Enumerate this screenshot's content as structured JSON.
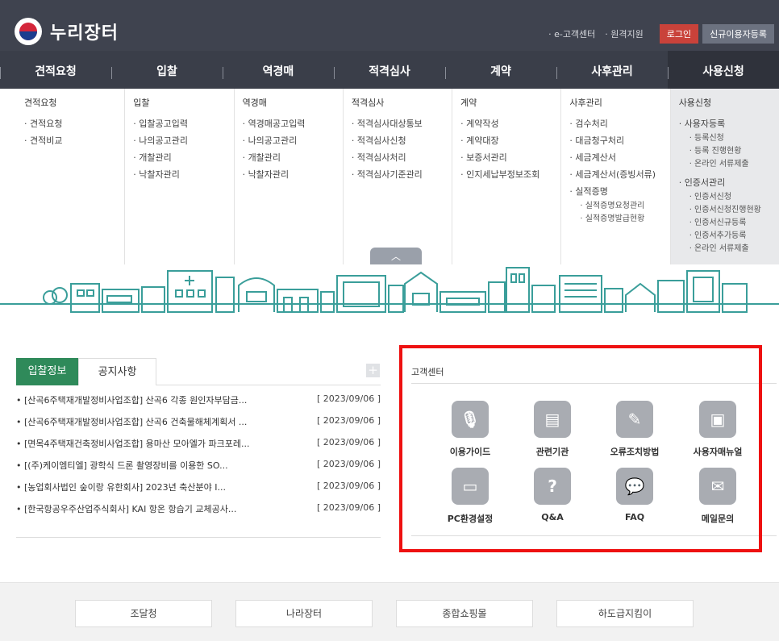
{
  "header": {
    "logo_text": "누리장터",
    "links": [
      "e-고객센터",
      "원격지원"
    ],
    "login": "로그인",
    "join": "신규이용자등록"
  },
  "gnb": [
    "견적요청",
    "입찰",
    "역경매",
    "적격심사",
    "계약",
    "사후관리",
    "사용신청"
  ],
  "mega": [
    {
      "title": "견적요청",
      "items": [
        "견적요청",
        "견적비교"
      ]
    },
    {
      "title": "입찰",
      "items": [
        "입찰공고입력",
        "나의공고관리",
        "개찰관리",
        "낙찰자관리"
      ]
    },
    {
      "title": "역경매",
      "items": [
        "역경매공고입력",
        "나의공고관리",
        "개찰관리",
        "낙찰자관리"
      ]
    },
    {
      "title": "적격심사",
      "items": [
        "적격심사대상통보",
        "적격심사신청",
        "적격심사처리",
        "적격심사기준관리"
      ]
    },
    {
      "title": "계약",
      "items": [
        "계약작성",
        "계약대장",
        "보증서관리",
        "인지세납부정보조회"
      ]
    },
    {
      "title": "사후관리",
      "items": [
        "검수처리",
        "대금청구처리",
        "세금계산서",
        "세금계산서(증빙서류)",
        "실적증명"
      ],
      "subs": [
        "실적증명요청관리",
        "실적증명발급현황"
      ]
    },
    {
      "title": "사용신청",
      "groups": [
        {
          "label": "사용자등록",
          "subs": [
            "등록신청",
            "등록 진행현황",
            "온라인 서류제출"
          ]
        },
        {
          "label": "인증서관리",
          "subs": [
            "인증서신청",
            "인증서신청진행현황",
            "인증서신규등록",
            "인증서추가등록",
            "온라인 서류제출"
          ]
        }
      ]
    }
  ],
  "toggle_icon": "chevron-up-icon",
  "tabs": {
    "on": "입찰정보",
    "off": "공지사항"
  },
  "news": [
    {
      "title": "[산곡6주택재개발정비사업조합] 산곡6 각종 원인자부담금...",
      "date": "[ 2023/09/06 ]"
    },
    {
      "title": "[산곡6주택재개발정비사업조합] 산곡6 건축물해체계획서 ...",
      "date": "[ 2023/09/06 ]"
    },
    {
      "title": "[면목4주택재건축정비사업조합] 용마산 모아엘가 파크포레...",
      "date": "[ 2023/09/06 ]"
    },
    {
      "title": "[(주)케이엠티엘] 광학식 드론 촬영장비를 이용한 SO...",
      "date": "[ 2023/09/06 ]"
    },
    {
      "title": "[농업회사법인 숲이랑 유한회사] 2023년 축산분야 I...",
      "date": "[ 2023/09/06 ]"
    },
    {
      "title": "[한국항공우주산업주식회사] KAI 항온 항습기 교체공사...",
      "date": "[ 2023/09/06 ]"
    }
  ],
  "customer_center": {
    "title": "고객센터",
    "services": [
      {
        "label": "이용가이드",
        "icon": "microphone-icon"
      },
      {
        "label": "관련기관",
        "icon": "clipboard-icon"
      },
      {
        "label": "오류조치방법",
        "icon": "wrench-icon"
      },
      {
        "label": "사용자매뉴얼",
        "icon": "user-card-icon"
      },
      {
        "label": "PC환경설정",
        "icon": "monitor-icon"
      },
      {
        "label": "Q&A",
        "icon": "question-icon"
      },
      {
        "label": "FAQ",
        "icon": "chat-icon"
      },
      {
        "label": "메일문의",
        "icon": "mail-icon"
      }
    ]
  },
  "footer": [
    "조달청",
    "나라장터",
    "종합쇼핑몰",
    "하도급지킴이"
  ]
}
